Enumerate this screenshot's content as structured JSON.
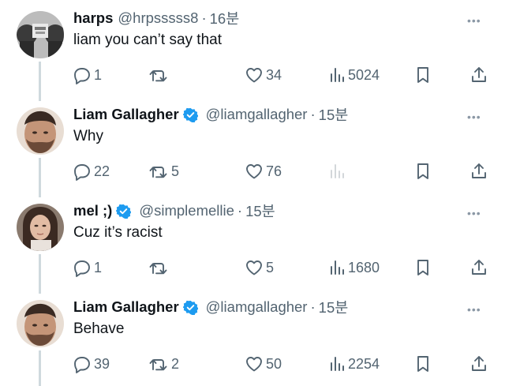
{
  "tweets": [
    {
      "name": "harps",
      "handle": "@hrpsssss8",
      "time": "16분",
      "text": "liam you can’t say that",
      "verified": false,
      "avatar": "avatar-harps",
      "reply_count": "1",
      "retweet_count": "",
      "like_count": "34",
      "view_count": "5024",
      "views_visible": true
    },
    {
      "name": "Liam Gallagher",
      "handle": "@liamgallagher",
      "time": "15분",
      "text": "Why",
      "verified": true,
      "avatar": "avatar-liam",
      "reply_count": "22",
      "retweet_count": "5",
      "like_count": "76",
      "view_count": "",
      "views_visible": false
    },
    {
      "name": "mel ;)",
      "handle": "@simplemellie",
      "time": "15분",
      "text": "Cuz it’s racist",
      "verified": true,
      "avatar": "avatar-mel",
      "reply_count": "1",
      "retweet_count": "",
      "like_count": "5",
      "view_count": "1680",
      "views_visible": true
    },
    {
      "name": "Liam Gallagher",
      "handle": "@liamgallagher",
      "time": "15분",
      "text": "Behave",
      "verified": true,
      "avatar": "avatar-liam",
      "reply_count": "39",
      "retweet_count": "2",
      "like_count": "50",
      "view_count": "2254",
      "views_visible": true
    }
  ],
  "colors": {
    "text": "#0f1419",
    "secondary": "#536471",
    "verified": "#1d9bf0",
    "thread_line": "#cfd9de"
  },
  "icons": [
    "reply-icon",
    "retweet-icon",
    "like-icon",
    "views-icon",
    "bookmark-icon",
    "share-icon",
    "more-icon",
    "verified-badge-icon"
  ]
}
